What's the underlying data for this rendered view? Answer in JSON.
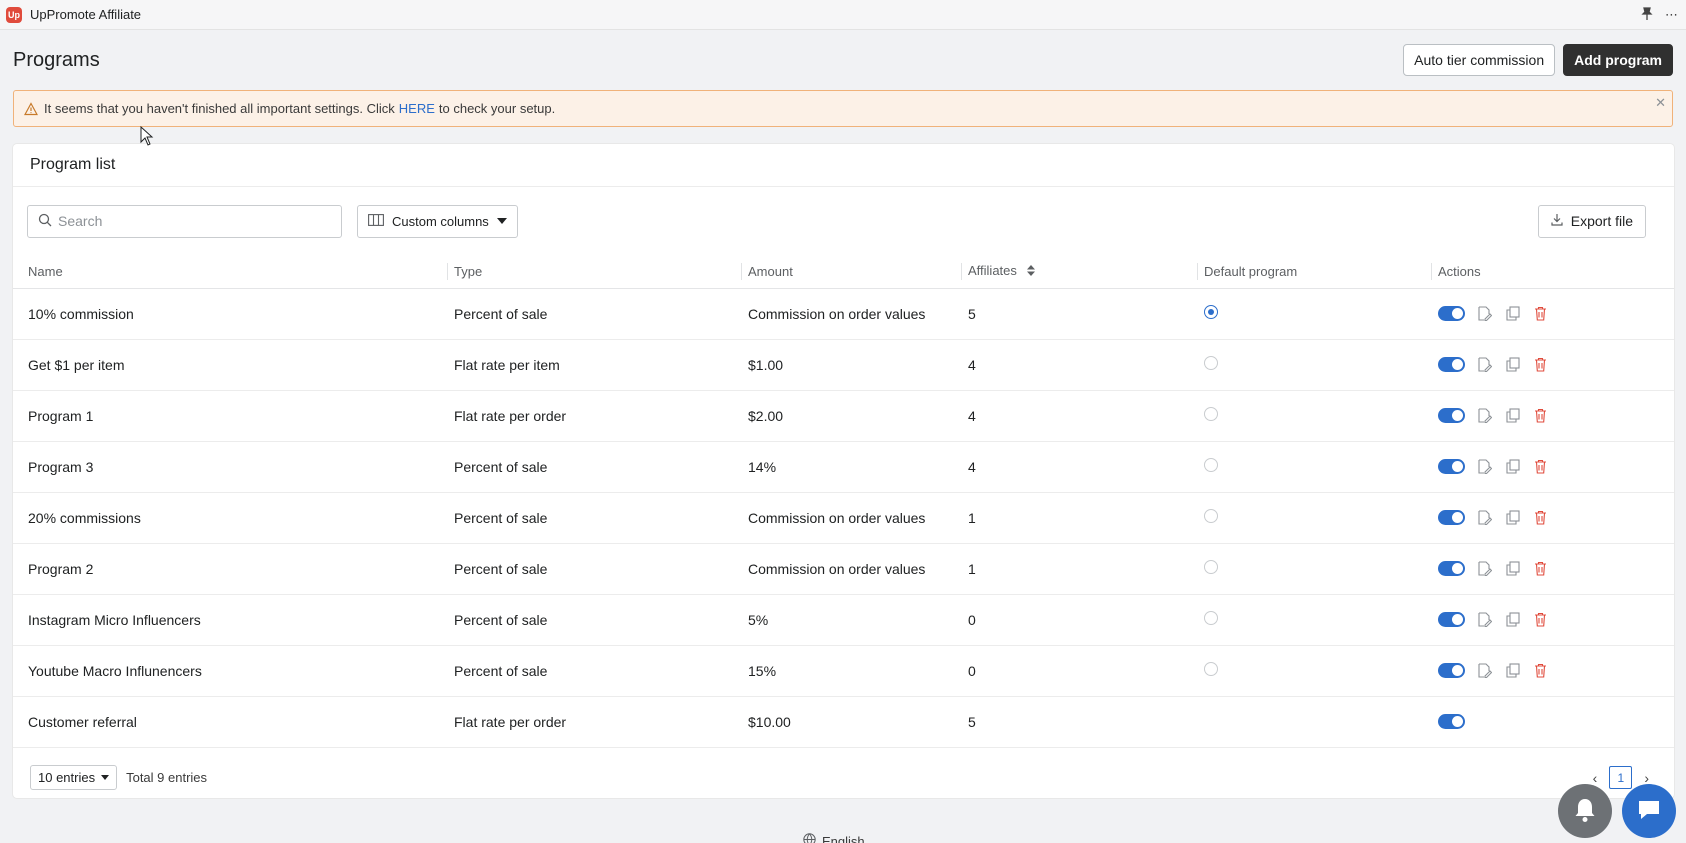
{
  "app": {
    "name": "UpPromote Affiliate",
    "logo_text": "Up"
  },
  "topbar": {
    "more": "⋯"
  },
  "header": {
    "title": "Programs",
    "auto_tier_label": "Auto tier commission",
    "add_program_label": "Add program"
  },
  "banner": {
    "text_before": "It seems that you haven't finished all important settings. Click",
    "link": "HERE",
    "text_after": "to check your setup.",
    "close": "✕"
  },
  "card": {
    "title": "Program list"
  },
  "toolbar": {
    "search_placeholder": "Search",
    "custom_columns_label": "Custom columns",
    "export_label": "Export file"
  },
  "columns": {
    "name": "Name",
    "type": "Type",
    "amount": "Amount",
    "affiliates": "Affiliates",
    "default": "Default program",
    "actions": "Actions"
  },
  "rows": [
    {
      "name": "10% commission",
      "type": "Percent of sale",
      "amount": "Commission on order values",
      "affiliates": "5",
      "default": true,
      "has_default": true,
      "full_actions": true
    },
    {
      "name": "Get $1 per item",
      "type": "Flat rate per item",
      "amount": "$1.00",
      "affiliates": "4",
      "default": false,
      "has_default": true,
      "full_actions": true
    },
    {
      "name": "Program 1",
      "type": "Flat rate per order",
      "amount": "$2.00",
      "affiliates": "4",
      "default": false,
      "has_default": true,
      "full_actions": true
    },
    {
      "name": "Program 3",
      "type": "Percent of sale",
      "amount": "14%",
      "affiliates": "4",
      "default": false,
      "has_default": true,
      "full_actions": true
    },
    {
      "name": "20% commissions",
      "type": "Percent of sale",
      "amount": "Commission on order values",
      "affiliates": "1",
      "default": false,
      "has_default": true,
      "full_actions": true
    },
    {
      "name": "Program 2",
      "type": "Percent of sale",
      "amount": "Commission on order values",
      "affiliates": "1",
      "default": false,
      "has_default": true,
      "full_actions": true
    },
    {
      "name": "Instagram Micro Influencers",
      "type": "Percent of sale",
      "amount": "5%",
      "affiliates": "0",
      "default": false,
      "has_default": true,
      "full_actions": true
    },
    {
      "name": "Youtube Macro Influnencers",
      "type": "Percent of sale",
      "amount": "15%",
      "affiliates": "0",
      "default": false,
      "has_default": true,
      "full_actions": true
    },
    {
      "name": "Customer referral",
      "type": "Flat rate per order",
      "amount": "$10.00",
      "affiliates": "5",
      "default": false,
      "has_default": false,
      "full_actions": false
    }
  ],
  "footer": {
    "entries_label": "10 entries",
    "total_label": "Total 9 entries",
    "current_page": "1",
    "prev": "‹",
    "next": "›"
  },
  "language": {
    "label": "English"
  },
  "colors": {
    "accent": "#2c6ecb",
    "danger": "#e04b3c",
    "warning_bg": "#fcf1e7",
    "warning_border": "#f0b27a"
  }
}
